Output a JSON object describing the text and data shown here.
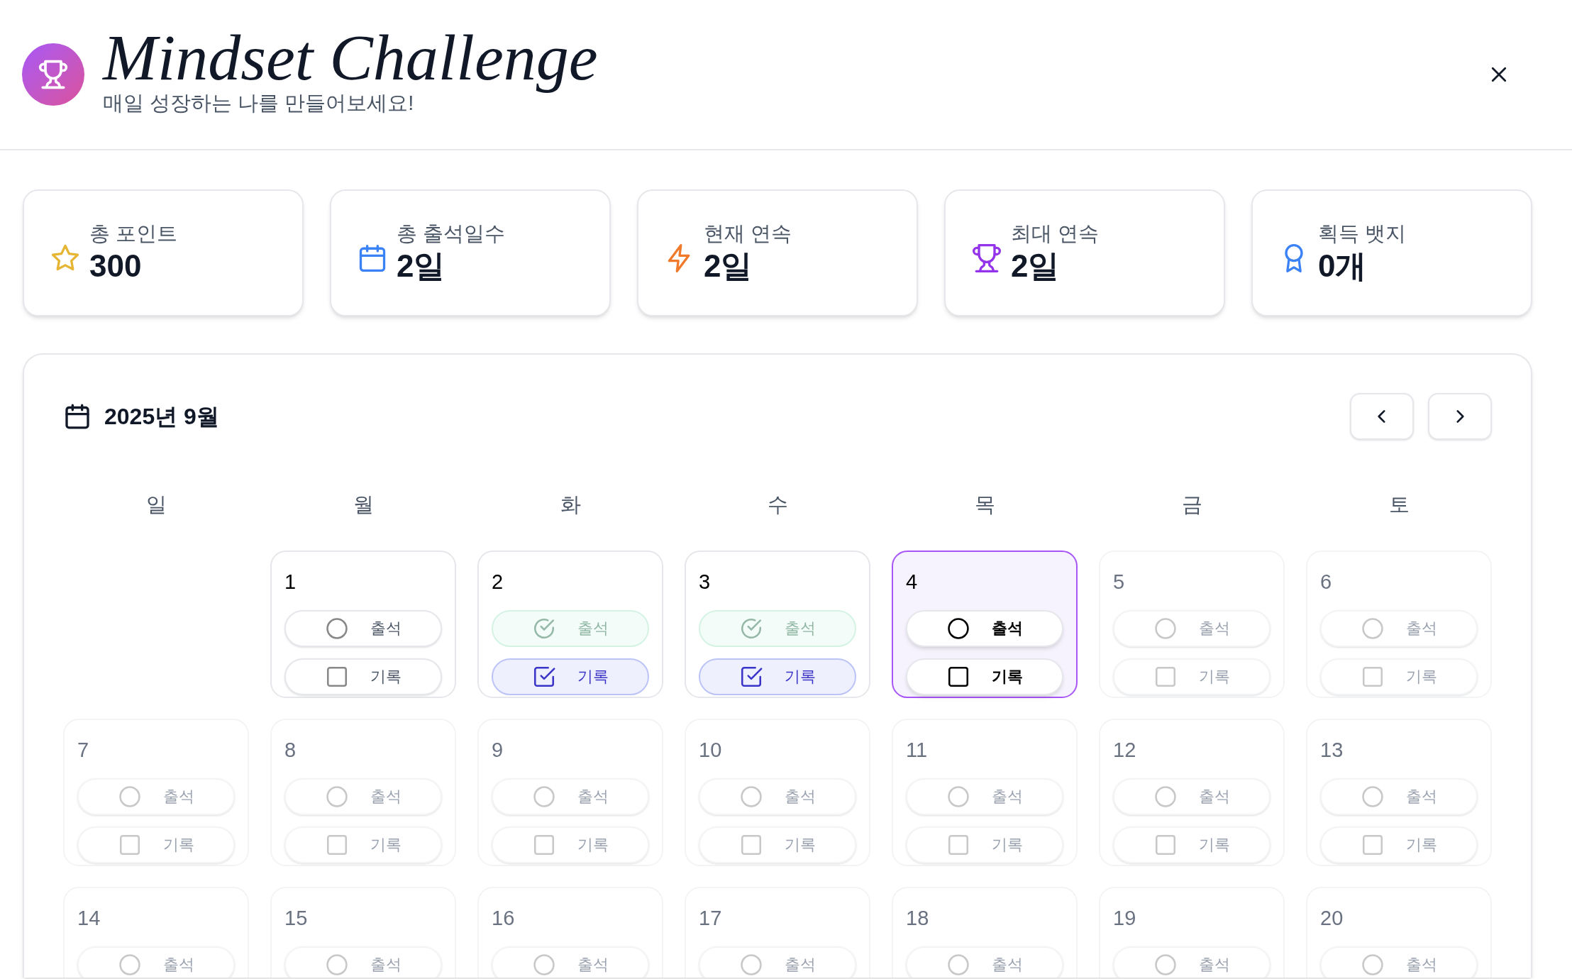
{
  "header": {
    "title": "Mindset Challenge",
    "subtitle": "매일 성장하는 나를 만들어보세요!"
  },
  "stats": [
    {
      "kind": "star",
      "label": "총 포인트",
      "value": "300"
    },
    {
      "kind": "calendar",
      "label": "총 출석일수",
      "value": "2일"
    },
    {
      "kind": "bolt",
      "label": "현재 연속",
      "value": "2일"
    },
    {
      "kind": "trophy",
      "label": "최대 연속",
      "value": "2일"
    },
    {
      "kind": "badge",
      "label": "획득 뱃지",
      "value": "0개"
    }
  ],
  "calendar": {
    "title": "2025년 9월",
    "weekdays": [
      "일",
      "월",
      "화",
      "수",
      "목",
      "금",
      "토"
    ],
    "weeks": [
      {
        "days": [
          {
            "day": "1",
            "selected": false,
            "disabled": false,
            "attendance": {
              "label": "출석",
              "checked": false
            },
            "record": {
              "label": "기록",
              "checked": false
            }
          },
          {
            "day": "2",
            "selected": false,
            "disabled": false,
            "attendance": {
              "label": "출석",
              "checked": true
            },
            "record": {
              "label": "기록",
              "checked": true
            }
          },
          {
            "day": "3",
            "selected": false,
            "disabled": false,
            "attendance": {
              "label": "출석",
              "checked": true
            },
            "record": {
              "label": "기록",
              "checked": true
            }
          },
          {
            "day": "4",
            "selected": true,
            "disabled": false,
            "attendance": {
              "label": "출석",
              "checked": false
            },
            "record": {
              "label": "기록",
              "checked": false
            }
          },
          {
            "day": "5",
            "selected": false,
            "disabled": true,
            "attendance": {
              "label": "출석",
              "checked": false
            },
            "record": {
              "label": "기록",
              "checked": false
            }
          },
          {
            "day": "6",
            "selected": false,
            "disabled": true,
            "attendance": {
              "label": "출석",
              "checked": false
            },
            "record": {
              "label": "기록",
              "checked": false
            }
          }
        ]
      },
      {
        "days": [
          {
            "day": "7",
            "selected": false,
            "disabled": true,
            "attendance": {
              "label": "출석",
              "checked": false
            },
            "record": {
              "label": "기록",
              "checked": false
            }
          },
          {
            "day": "8",
            "selected": false,
            "disabled": true,
            "attendance": {
              "label": "출석",
              "checked": false
            },
            "record": {
              "label": "기록",
              "checked": false
            }
          },
          {
            "day": "9",
            "selected": false,
            "disabled": true,
            "attendance": {
              "label": "출석",
              "checked": false
            },
            "record": {
              "label": "기록",
              "checked": false
            }
          },
          {
            "day": "10",
            "selected": false,
            "disabled": true,
            "attendance": {
              "label": "출석",
              "checked": false
            },
            "record": {
              "label": "기록",
              "checked": false
            }
          },
          {
            "day": "11",
            "selected": false,
            "disabled": true,
            "attendance": {
              "label": "출석",
              "checked": false
            },
            "record": {
              "label": "기록",
              "checked": false
            }
          },
          {
            "day": "12",
            "selected": false,
            "disabled": true,
            "attendance": {
              "label": "출석",
              "checked": false
            },
            "record": {
              "label": "기록",
              "checked": false
            }
          },
          {
            "day": "13",
            "selected": false,
            "disabled": true,
            "attendance": {
              "label": "출석",
              "checked": false
            },
            "record": {
              "label": "기록",
              "checked": false
            }
          }
        ]
      },
      {
        "days": [
          {
            "day": "14",
            "selected": false,
            "disabled": true,
            "attendance": {
              "label": "출석",
              "checked": false
            }
          },
          {
            "day": "15",
            "selected": false,
            "disabled": true,
            "attendance": {
              "label": "출석",
              "checked": false
            }
          },
          {
            "day": "16",
            "selected": false,
            "disabled": true,
            "attendance": {
              "label": "출석",
              "checked": false
            }
          },
          {
            "day": "17",
            "selected": false,
            "disabled": true,
            "attendance": {
              "label": "출석",
              "checked": false
            }
          },
          {
            "day": "18",
            "selected": false,
            "disabled": true,
            "attendance": {
              "label": "출석",
              "checked": false
            }
          },
          {
            "day": "19",
            "selected": false,
            "disabled": true,
            "attendance": {
              "label": "출석",
              "checked": false
            }
          },
          {
            "day": "20",
            "selected": false,
            "disabled": true,
            "attendance": {
              "label": "출석",
              "checked": false
            }
          }
        ]
      }
    ]
  }
}
